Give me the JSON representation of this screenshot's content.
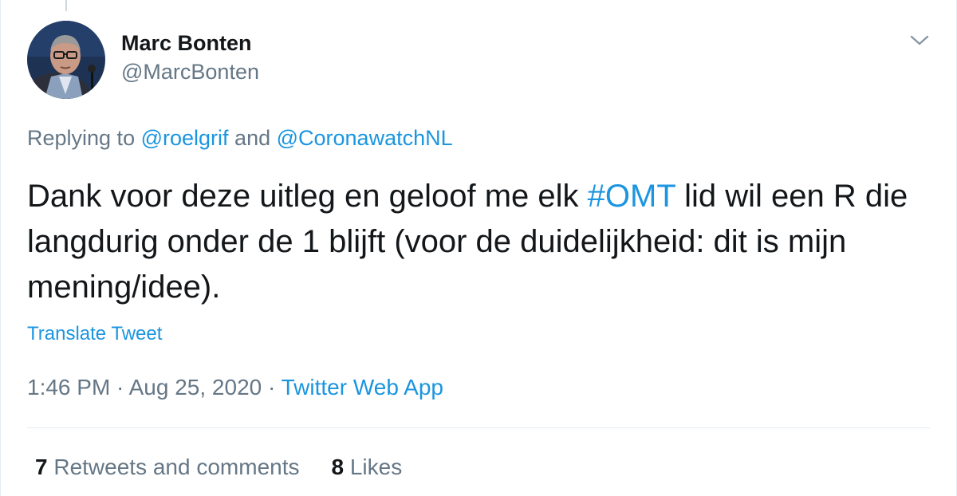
{
  "author": {
    "display_name": "Marc Bonten",
    "handle": "@MarcBonten"
  },
  "replying": {
    "prefix": "Replying to ",
    "user1": "@roelgrif",
    "joiner": " and ",
    "user2": "@CoronawatchNL"
  },
  "tweet": {
    "text_part1": "Dank voor deze uitleg en geloof me elk ",
    "hashtag": "#OMT",
    "text_part2": " lid wil een R die langdurig onder de 1 blijft (voor de duidelijkheid: dit is mijn mening/idee)."
  },
  "translate_label": "Translate Tweet",
  "meta": {
    "time": "1:46 PM",
    "separator1": " · ",
    "date": "Aug 25, 2020",
    "separator2": " · ",
    "source": "Twitter Web App"
  },
  "stats": {
    "retweets_count": "7",
    "retweets_label": " Retweets and comments",
    "likes_count": "8",
    "likes_label": " Likes"
  },
  "icons": {
    "menu": "chevron-down-icon",
    "avatar": "profile-photo"
  },
  "colors": {
    "link": "#1b95e0",
    "secondary_text": "#657786",
    "primary_text": "#14171a",
    "border": "#e6ecf0"
  }
}
